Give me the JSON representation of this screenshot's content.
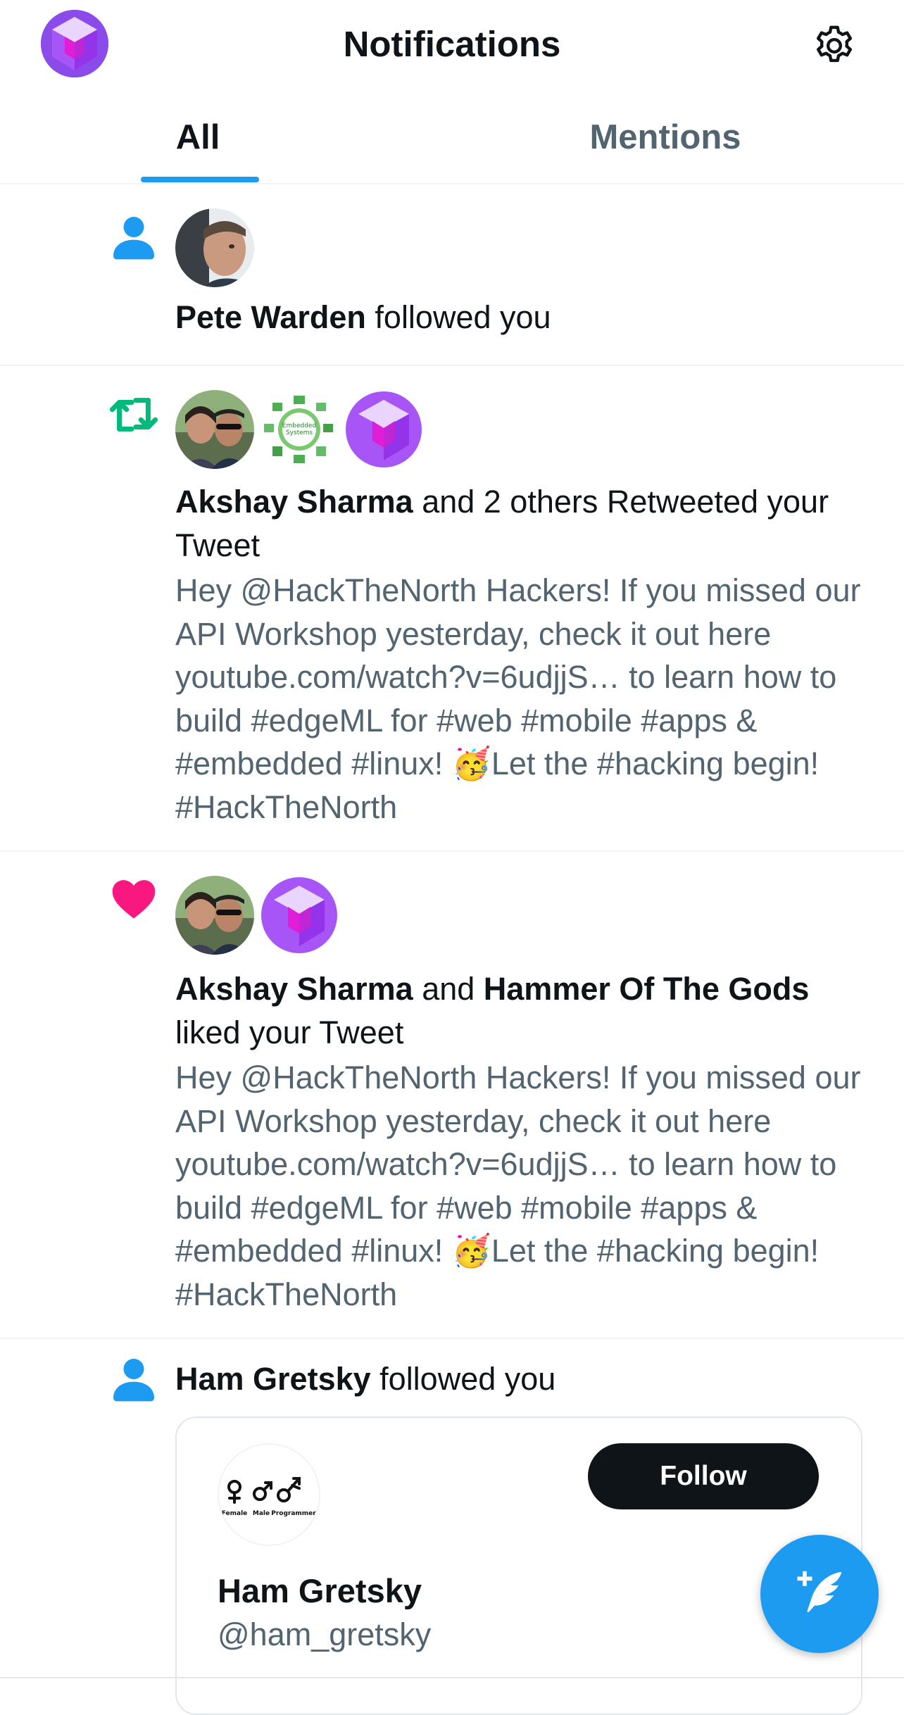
{
  "header": {
    "title": "Notifications"
  },
  "tabs": {
    "all": "All",
    "mentions": "Mentions",
    "active": "All"
  },
  "notifications": [
    {
      "type": "follow",
      "actor": "Pete Warden",
      "action": " followed you"
    },
    {
      "type": "retweet",
      "actor": "Akshay Sharma",
      "action": " and 2 others Retweeted your Tweet",
      "tweet": "Hey @HackTheNorth Hackers! If you missed our API Workshop yesterday, check it out here youtube.com/watch?v=6udjjS… to learn how to build #edgeML for #web #mobile #apps & #embedded #linux! 🥳Let the #hacking begin! #HackTheNorth"
    },
    {
      "type": "like",
      "actor": "Akshay Sharma",
      "joiner": " and ",
      "actor2": "Hammer Of The Gods",
      "action": " liked your Tweet",
      "tweet": "Hey @HackTheNorth Hackers! If you missed our API Workshop yesterday, check it out here youtube.com/watch?v=6udjjS… to learn how to build #edgeML for #web #mobile #apps & #embedded #linux! 🥳Let the #hacking begin! #HackTheNorth"
    },
    {
      "type": "follow",
      "actor": "Ham Gretsky",
      "action": " followed you",
      "card": {
        "name": "Ham Gretsky",
        "handle": "@ham_gretsky",
        "follow_label": "Follow",
        "avatar_labels": [
          "Female",
          "Male",
          "Programmer"
        ]
      }
    }
  ],
  "colors": {
    "accent": "#1d9bf0",
    "retweet": "#00ba7c",
    "like": "#f91880",
    "secondary_text": "#536471",
    "primary_text": "#0f1419"
  },
  "icons": [
    "logo-avatar",
    "gear-icon",
    "person-icon",
    "retweet-icon",
    "heart-icon",
    "compose-tweet-icon"
  ]
}
